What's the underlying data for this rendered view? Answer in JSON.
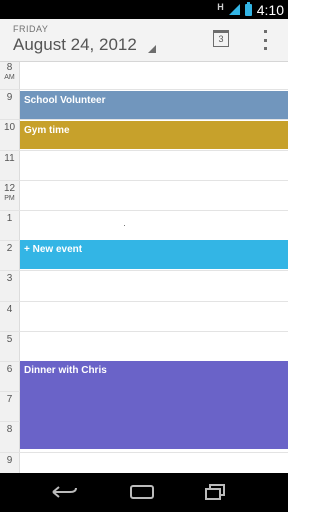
{
  "status_bar": {
    "network": "H",
    "time": "4:10",
    "accent": "#33b5e5"
  },
  "header": {
    "day_of_week": "FRIDAY",
    "date": "August 24, 2012",
    "today_icon_day": "3"
  },
  "hours": [
    {
      "label": "8",
      "ampm": "AM"
    },
    {
      "label": "9",
      "ampm": ""
    },
    {
      "label": "10",
      "ampm": ""
    },
    {
      "label": "11",
      "ampm": ""
    },
    {
      "label": "12",
      "ampm": "PM"
    },
    {
      "label": "1",
      "ampm": ""
    },
    {
      "label": "2",
      "ampm": ""
    },
    {
      "label": "3",
      "ampm": ""
    },
    {
      "label": "4",
      "ampm": ""
    },
    {
      "label": "5",
      "ampm": ""
    },
    {
      "label": "6",
      "ampm": ""
    },
    {
      "label": "7",
      "ampm": ""
    },
    {
      "label": "8",
      "ampm": ""
    },
    {
      "label": "9",
      "ampm": ""
    }
  ],
  "events": [
    {
      "title": "School Volunteer",
      "color": "#7196bd"
    },
    {
      "title": "Gym time",
      "color": "#c7a12b"
    },
    {
      "title": "+ New event",
      "color": "#33b5e5"
    },
    {
      "title": "Dinner with Chris",
      "color": "#6a63c8"
    }
  ],
  "nav": {
    "back": "back-icon",
    "home": "home-icon",
    "recents": "recents-icon"
  }
}
